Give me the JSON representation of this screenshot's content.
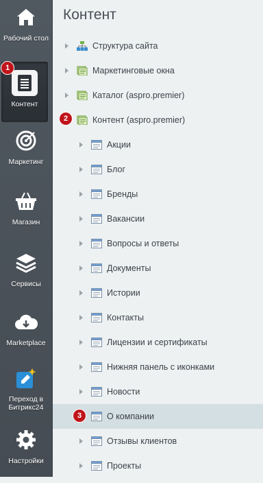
{
  "sidebar": {
    "items": [
      {
        "label": "Рабочий стол",
        "icon": "home-icon"
      },
      {
        "label": "Контент",
        "icon": "document-icon",
        "active": true
      },
      {
        "label": "Маркетинг",
        "icon": "target-icon"
      },
      {
        "label": "Магазин",
        "icon": "basket-icon"
      },
      {
        "label": "Сервисы",
        "icon": "layers-icon"
      },
      {
        "label": "Marketplace",
        "icon": "cloud-download-icon"
      },
      {
        "label": "Переход в Битрикс24",
        "icon": "bitrix24-icon"
      },
      {
        "label": "Настройки",
        "icon": "gear-icon"
      }
    ]
  },
  "page_title": "Контент",
  "tree": {
    "root": [
      {
        "label": "Структура сайта",
        "icon": "sitemap-icon"
      },
      {
        "label": "Маркетинговые окна",
        "icon": "iblock-type-icon"
      },
      {
        "label": "Каталог (aspro.premier)",
        "icon": "iblock-type-icon"
      },
      {
        "label": "Контент (aspro.premier)",
        "icon": "iblock-type-icon"
      }
    ],
    "children": [
      "Акции",
      "Блог",
      "Бренды",
      "Вакансии",
      "Вопросы и ответы",
      "Документы",
      "Истории",
      "Контакты",
      "Лицензии и сертификаты",
      "Нижняя панель с иконками",
      "Новости",
      "О компании",
      "Отзывы клиентов",
      "Проекты"
    ],
    "selected_child": "О компании"
  },
  "badges": [
    "1",
    "2",
    "3"
  ],
  "colors": {
    "sidebar_bg": "#4a5259",
    "main_bg": "#edf1f2",
    "selected_row": "#d4dfe3",
    "badge": "#c0141b"
  }
}
